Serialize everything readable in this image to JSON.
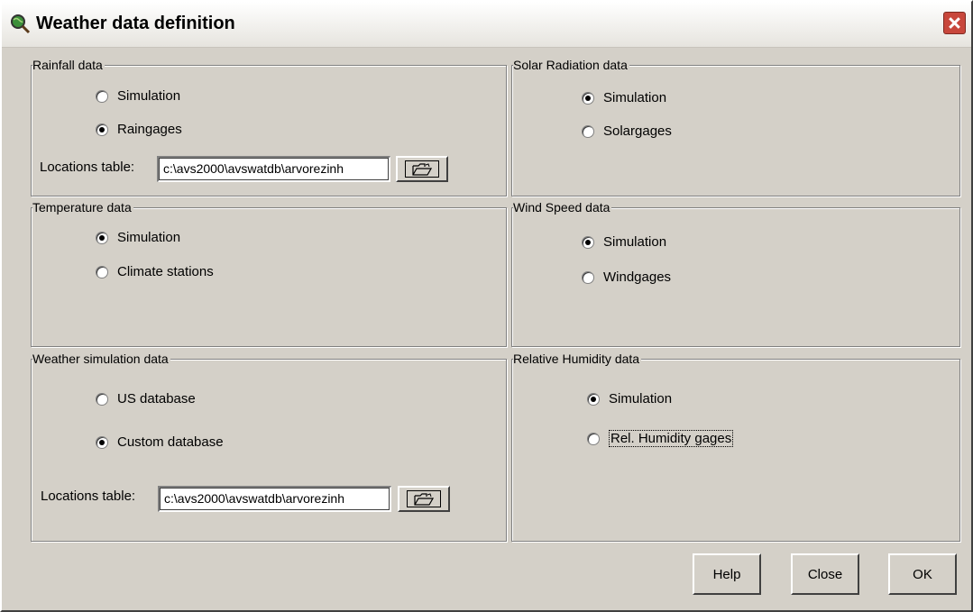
{
  "window": {
    "title": "Weather data definition"
  },
  "rainfall": {
    "label": "Rainfall data",
    "options": [
      {
        "label": "Simulation",
        "checked": false
      },
      {
        "label": "Raingages",
        "checked": true
      }
    ],
    "locations_label": "Locations table:",
    "locations_value": "c:\\avs2000\\avswatdb\\arvorezinh"
  },
  "solar": {
    "label": "Solar Radiation data",
    "options": [
      {
        "label": "Simulation",
        "checked": true
      },
      {
        "label": "Solargages",
        "checked": false
      }
    ]
  },
  "temperature": {
    "label": "Temperature data",
    "options": [
      {
        "label": "Simulation",
        "checked": true
      },
      {
        "label": "Climate stations",
        "checked": false
      }
    ]
  },
  "wind": {
    "label": "Wind Speed data",
    "options": [
      {
        "label": "Simulation",
        "checked": true
      },
      {
        "label": "Windgages",
        "checked": false
      }
    ]
  },
  "weather_sim": {
    "label": "Weather simulation data",
    "options": [
      {
        "label": "US database",
        "checked": false
      },
      {
        "label": "Custom database",
        "checked": true
      }
    ],
    "locations_label": "Locations table:",
    "locations_value": "c:\\avs2000\\avswatdb\\arvorezinh"
  },
  "humidity": {
    "label": "Relative Humidity data",
    "options": [
      {
        "label": "Simulation",
        "checked": true
      },
      {
        "label": "Rel. Humidity gages",
        "checked": false
      }
    ]
  },
  "buttons": {
    "help": "Help",
    "close": "Close",
    "ok": "OK"
  },
  "icons": {
    "app": "globe-magnifier-icon",
    "close": "close-icon",
    "browse": "open-folder-icon"
  }
}
